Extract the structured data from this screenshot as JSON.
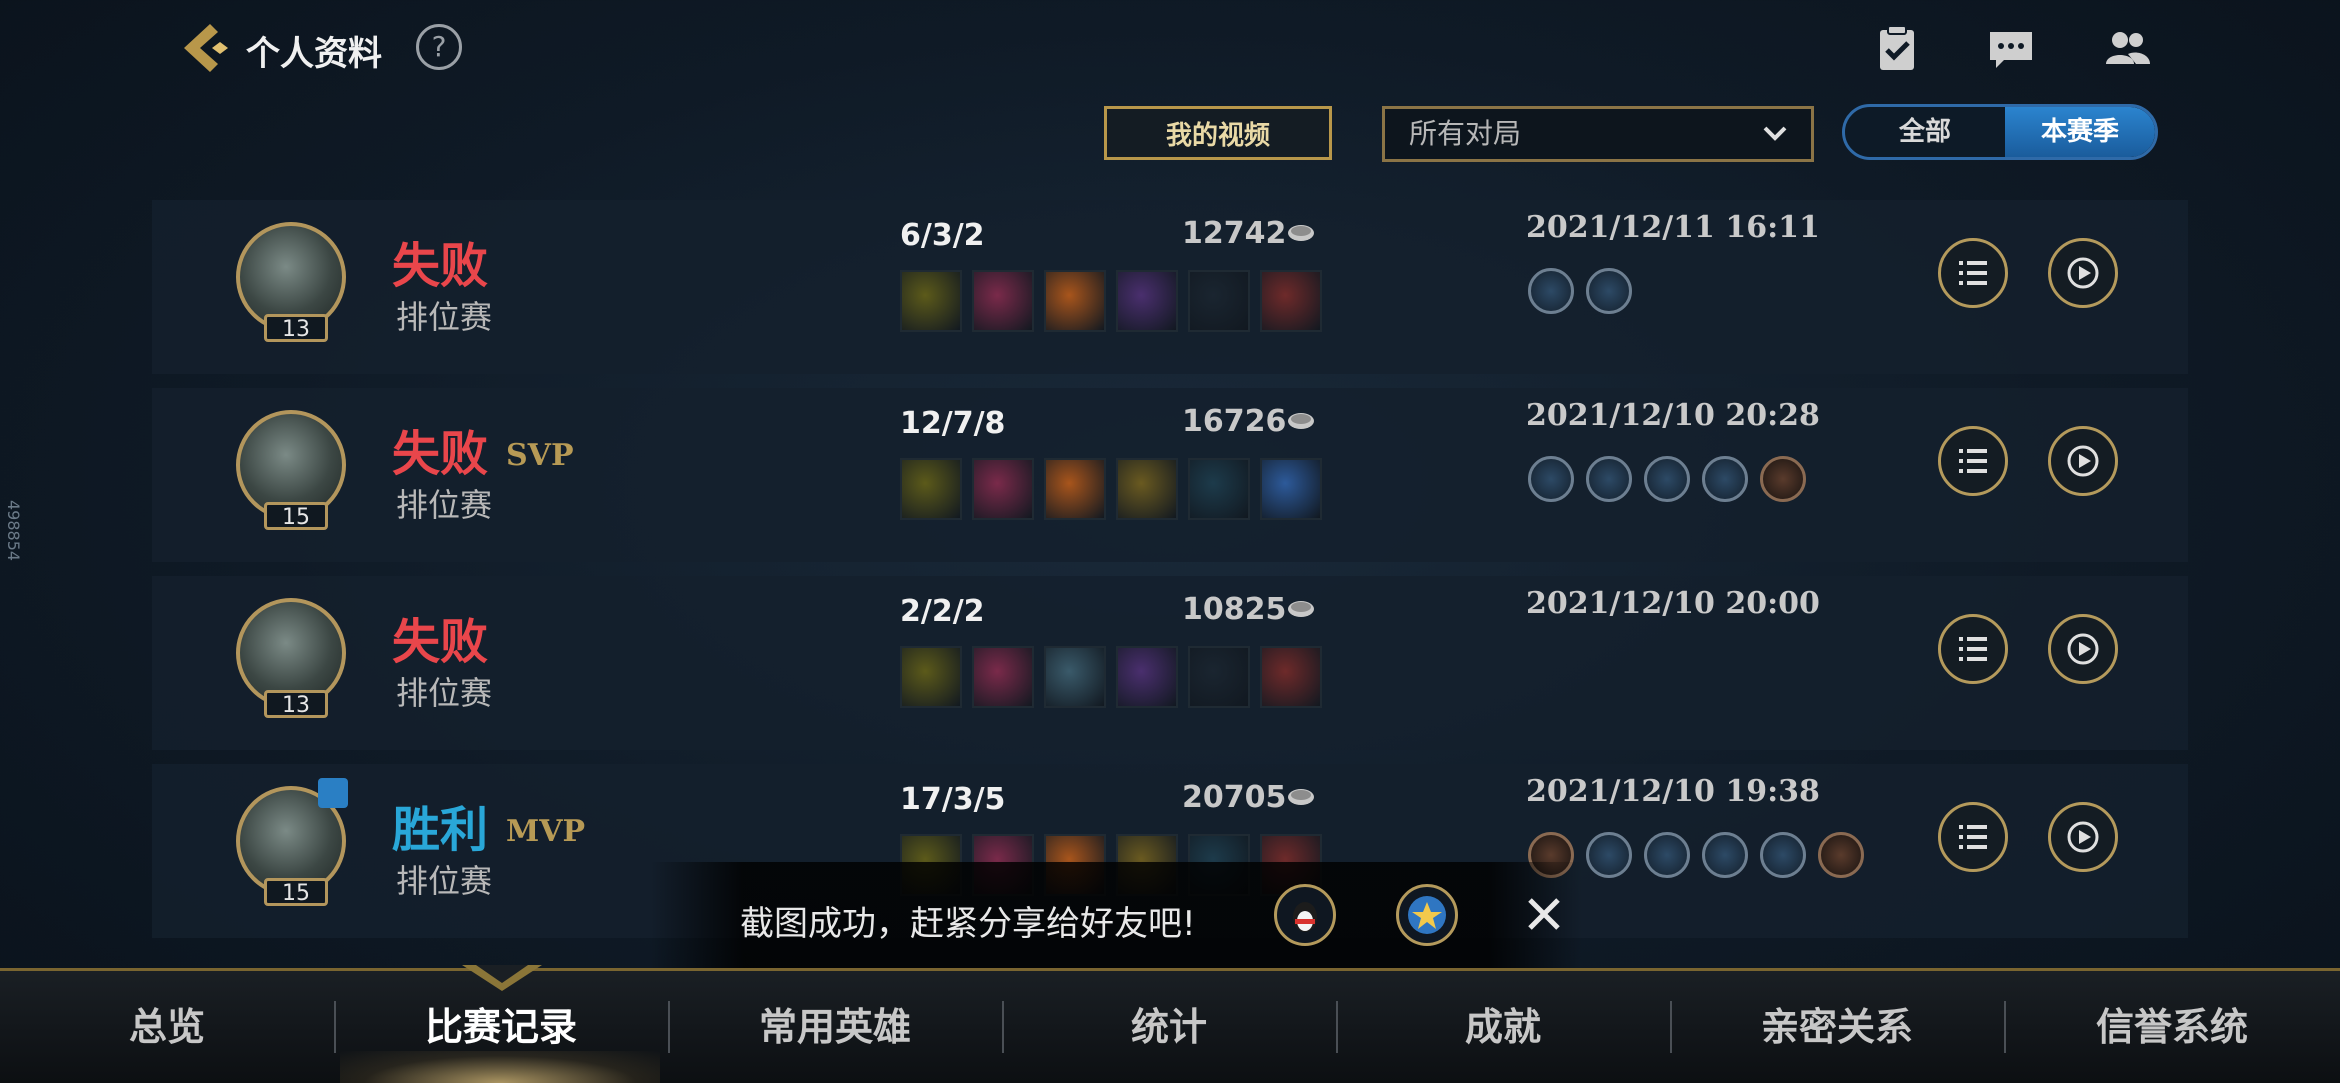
{
  "header": {
    "title": "个人资料",
    "help": "?"
  },
  "filters": {
    "my_videos": "我的视频",
    "match_filter": "所有对局",
    "segment": [
      "全部",
      "本赛季"
    ]
  },
  "side_id": "498854",
  "matches": [
    {
      "result": "失败",
      "badge_tag": "",
      "mode": "排位赛",
      "level": "13",
      "kda": "6/3/2",
      "gold": "12742",
      "datetime": "2021/12/11 16:11",
      "items": [
        "#5c5a1a",
        "#7a2a4a",
        "#a8551c",
        "#4a2f6e",
        "#1a2530",
        "#6e2a2a"
      ],
      "badges": [
        "silver",
        "silver"
      ]
    },
    {
      "result": "失败",
      "badge_tag": "SVP",
      "mode": "排位赛",
      "level": "15",
      "kda": "12/7/8",
      "gold": "16726",
      "datetime": "2021/12/10 20:28",
      "items": [
        "#5c5a1a",
        "#7a2a4a",
        "#a8551c",
        "#6a5a20",
        "#1d3b4b",
        "#2d5a9a"
      ],
      "badges": [
        "silver",
        "silver",
        "silver",
        "silver",
        "bronze"
      ]
    },
    {
      "result": "失败",
      "badge_tag": "",
      "mode": "排位赛",
      "level": "13",
      "kda": "2/2/2",
      "gold": "10825",
      "datetime": "2021/12/10 20:00",
      "items": [
        "#5c5a1a",
        "#7a2a4a",
        "#3a5a6a",
        "#4a2f6e",
        "#1a2530",
        "#6e2a2a"
      ],
      "badges": []
    },
    {
      "result": "胜利",
      "badge_tag": "MVP",
      "mode": "排位赛",
      "level": "15",
      "kda": "17/3/5",
      "gold": "20705",
      "datetime": "2021/12/10 19:38",
      "items": [
        "#5c5a1a",
        "#7a2a4a",
        "#a8551c",
        "#6a5a20",
        "#1d3b4b",
        "#6e2a2a"
      ],
      "badges": [
        "bronze",
        "silver",
        "silver",
        "silver",
        "silver",
        "bronze"
      ]
    }
  ],
  "toast": {
    "message": "截图成功，赶紧分享给好友吧!"
  },
  "nav": [
    "总览",
    "比赛记录",
    "常用英雄",
    "统计",
    "成就",
    "亲密关系",
    "信誉系统"
  ],
  "colors": {
    "lose": "#e9464b",
    "win": "#29a7d8",
    "gold_accent": "#b49a5c",
    "tab_active": "#2b84cf"
  }
}
